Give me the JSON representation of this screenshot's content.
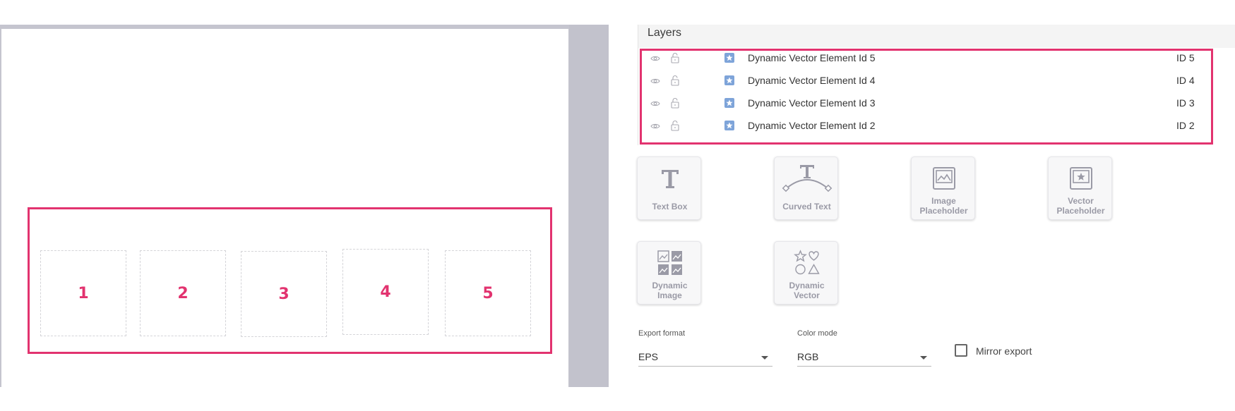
{
  "canvas": {
    "slots": [
      "1",
      "2",
      "3",
      "4",
      "5"
    ]
  },
  "layers": {
    "title": "Layers",
    "items": [
      {
        "name": "Dynamic Vector Element Id 5",
        "id": "ID 5"
      },
      {
        "name": "Dynamic Vector Element Id 4",
        "id": "ID 4"
      },
      {
        "name": "Dynamic Vector Element Id 3",
        "id": "ID 3"
      },
      {
        "name": "Dynamic Vector Element Id 2",
        "id": "ID 2"
      }
    ]
  },
  "tools": {
    "text_box": "Text Box",
    "curved_text": "Curved Text",
    "image_placeholder_1": "Image",
    "image_placeholder_2": "Placeholder",
    "vector_placeholder_1": "Vector",
    "vector_placeholder_2": "Placeholder",
    "dynamic_image_1": "Dynamic",
    "dynamic_image_2": "Image",
    "dynamic_vector_1": "Dynamic",
    "dynamic_vector_2": "Vector"
  },
  "export": {
    "format_label": "Export format",
    "format_value": "EPS",
    "color_label": "Color mode",
    "color_value": "RGB",
    "mirror_label": "Mirror export",
    "mirror_checked": false
  },
  "colors": {
    "accent": "#e2336f",
    "layer_icon": "#7ea4d9",
    "canvas_bg": "#c5c5cf"
  }
}
